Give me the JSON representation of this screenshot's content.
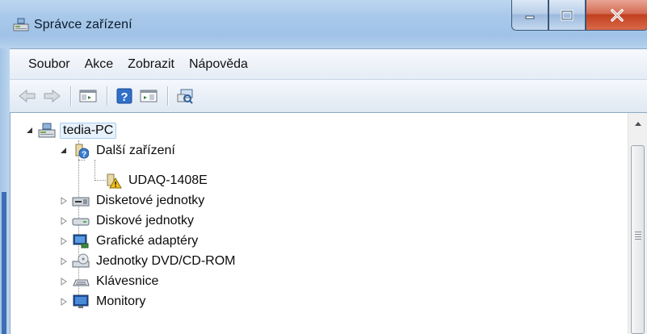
{
  "window": {
    "title": "Správce zařízení"
  },
  "menu": [
    "Soubor",
    "Akce",
    "Zobrazit",
    "Nápověda"
  ],
  "toolbar": {
    "buttons": [
      "back-arrow-icon",
      "forward-arrow-icon",
      "show-hide-console-tree-icon",
      "help-icon",
      "properties-icon",
      "scan-hardware-icon"
    ]
  },
  "tree": {
    "root": "tedia-PC",
    "items": [
      {
        "label": "Další zařízení",
        "icon": "unknown-device-icon",
        "expanded": true,
        "children": [
          {
            "label": "UDAQ-1408E",
            "icon": "warning-device-icon"
          }
        ]
      },
      {
        "label": "Disketové jednotky",
        "icon": "floppy-drive-icon",
        "expanded": false
      },
      {
        "label": "Diskové jednotky",
        "icon": "disk-drive-icon",
        "expanded": false
      },
      {
        "label": "Grafické adaptéry",
        "icon": "display-adapter-icon",
        "expanded": false
      },
      {
        "label": "Jednotky DVD/CD-ROM",
        "icon": "dvd-drive-icon",
        "expanded": false
      },
      {
        "label": "Klávesnice",
        "icon": "keyboard-icon",
        "expanded": false
      },
      {
        "label": "Monitory",
        "icon": "monitor-icon",
        "expanded": false
      }
    ]
  },
  "colors": {
    "selection_bg": "#e7f1fb",
    "selection_border": "#a9cdf0",
    "close_red": "#c2401f",
    "frame": "#a9c9ea"
  }
}
